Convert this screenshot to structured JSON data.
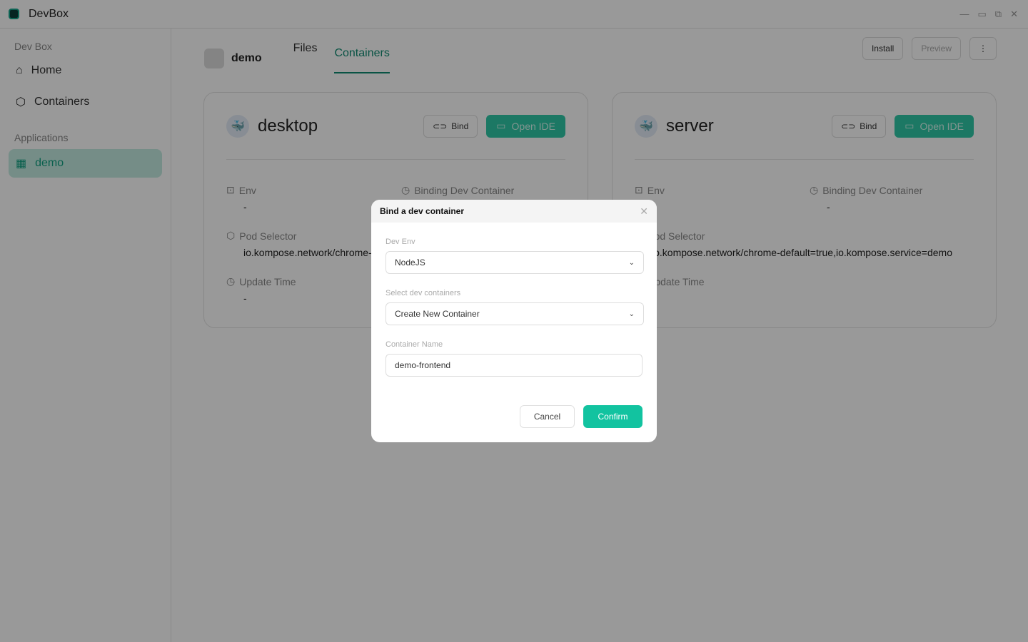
{
  "app": {
    "title": "DevBox"
  },
  "sidebar": {
    "section1": "Dev Box",
    "items": [
      {
        "label": "Home",
        "icon": "home-icon"
      },
      {
        "label": "Containers",
        "icon": "cube-icon"
      }
    ],
    "section2": "Applications",
    "apps": [
      {
        "label": "demo",
        "icon": "grid-icon",
        "active": true
      }
    ]
  },
  "header": {
    "app_name": "demo",
    "tabs": [
      {
        "label": "Files"
      },
      {
        "label": "Containers",
        "active": true
      }
    ],
    "install": "Install",
    "preview": "Preview"
  },
  "cards": [
    {
      "name": "desktop",
      "bind": "Bind",
      "open_ide": "Open IDE",
      "env_label": "Env",
      "env": "-",
      "binding_label": "Binding Dev Container",
      "binding": "-",
      "pod_label": "Pod Selector",
      "pod": "io.kompose.network/chrome-default=true,io.kompose.service=demo",
      "update_label": "Update Time",
      "update": "-"
    },
    {
      "name": "server",
      "bind": "Bind",
      "open_ide": "Open IDE",
      "env_label": "Env",
      "env": "-",
      "binding_label": "Binding Dev Container",
      "binding": "-",
      "pod_label": "Pod Selector",
      "pod": "io.kompose.network/chrome-default=true,io.kompose.service=demo",
      "update_label": "Update Time",
      "update": "-"
    }
  ],
  "modal": {
    "title": "Bind a dev container",
    "dev_env_label": "Dev Env",
    "dev_env": "NodeJS",
    "select_label": "Select dev containers",
    "select": "Create New Container",
    "name_label": "Container Name",
    "name": "demo-frontend",
    "cancel": "Cancel",
    "confirm": "Confirm"
  },
  "colors": {
    "accent": "#12c3a0",
    "active_tab": "#0f8a72"
  }
}
